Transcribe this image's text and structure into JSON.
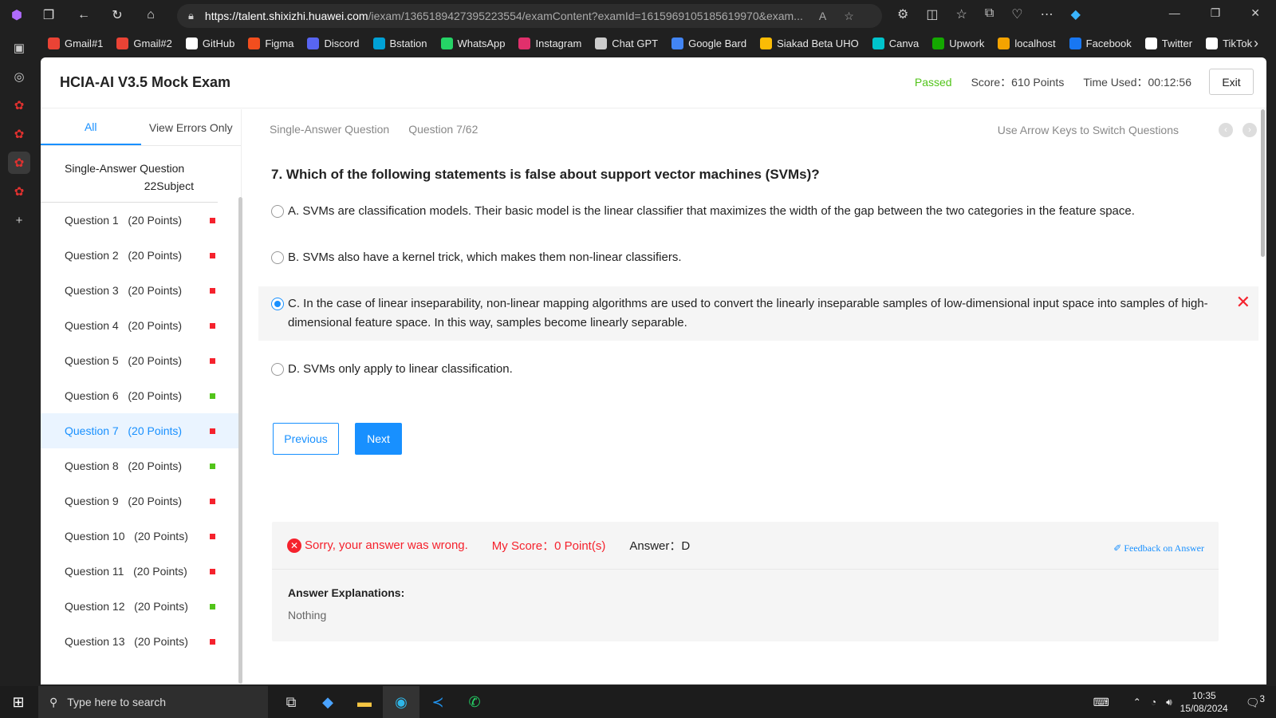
{
  "browser": {
    "url_host": "https://talent.shixizhi.huawei.com",
    "url_path": "/iexam/1365189427395223554/examContent?examId=1615969105185619970&exam...",
    "bookmarks": [
      {
        "label": "Gmail#1",
        "color": "#ea4335"
      },
      {
        "label": "Gmail#2",
        "color": "#ea4335"
      },
      {
        "label": "GitHub",
        "color": "#ffffff"
      },
      {
        "label": "Figma",
        "color": "#f24e1e"
      },
      {
        "label": "Discord",
        "color": "#5865f2"
      },
      {
        "label": "Bstation",
        "color": "#00a1d6"
      },
      {
        "label": "WhatsApp",
        "color": "#25d366"
      },
      {
        "label": "Instagram",
        "color": "#e1306c"
      },
      {
        "label": "Chat GPT",
        "color": "#cccccc"
      },
      {
        "label": "Google Bard",
        "color": "#4285f4"
      },
      {
        "label": "Siakad Beta UHO",
        "color": "#fbbc05"
      },
      {
        "label": "Canva",
        "color": "#00c4cc"
      },
      {
        "label": "Upwork",
        "color": "#14a800"
      },
      {
        "label": "localhost",
        "color": "#f4a300"
      },
      {
        "label": "Facebook",
        "color": "#1877f2"
      },
      {
        "label": "Twitter",
        "color": "#ffffff"
      },
      {
        "label": "TikTok",
        "color": "#ffffff"
      }
    ]
  },
  "header": {
    "title": "HCIA-AI V3.5 Mock Exam",
    "status": "Passed",
    "score": "Score：610 Points",
    "time_used": "Time Used：00:12:56",
    "exit_label": "Exit"
  },
  "sidebar": {
    "tab_all": "All",
    "tab_errors": "View Errors Only",
    "section_title": "Single-Answer Question",
    "section_count": "22Subject",
    "questions": [
      {
        "label": "Question 1   (20 Points)",
        "status": "wrong"
      },
      {
        "label": "Question 2   (20 Points)",
        "status": "wrong"
      },
      {
        "label": "Question 3   (20 Points)",
        "status": "wrong"
      },
      {
        "label": "Question 4   (20 Points)",
        "status": "wrong"
      },
      {
        "label": "Question 5   (20 Points)",
        "status": "wrong"
      },
      {
        "label": "Question 6   (20 Points)",
        "status": "correct"
      },
      {
        "label": "Question 7   (20 Points)",
        "status": "wrong",
        "active": true
      },
      {
        "label": "Question 8   (20 Points)",
        "status": "correct"
      },
      {
        "label": "Question 9   (20 Points)",
        "status": "wrong"
      },
      {
        "label": "Question 10   (20 Points)",
        "status": "wrong"
      },
      {
        "label": "Question 11   (20 Points)",
        "status": "wrong"
      },
      {
        "label": "Question 12   (20 Points)",
        "status": "correct"
      },
      {
        "label": "Question 13   (20 Points)",
        "status": "wrong"
      }
    ],
    "colors": {
      "wrong": "#f5222d",
      "correct": "#52c41a"
    }
  },
  "main": {
    "qtype": "Single-Answer Question",
    "progress": "Question 7/62",
    "hint": "Use Arrow Keys to Switch Questions",
    "question": "7. Which of the following statements is false about support vector machines (SVMs)?",
    "options": [
      {
        "text": "A. SVMs are classification models. Their basic model is the linear classifier that maximizes the width of the gap between the two categories in the feature space.",
        "selected": false
      },
      {
        "text": "B. SVMs also have a kernel trick, which makes them non-linear classifiers.",
        "selected": false
      },
      {
        "text": "C. In the case of linear inseparability, non-linear mapping algorithms are used to convert the linearly inseparable samples of low-dimensional input space into samples of high-dimensional feature space. In this way, samples become linearly separable.",
        "selected": true
      },
      {
        "text": "D. SVMs only apply to linear classification.",
        "selected": false
      }
    ],
    "prev_label": "Previous",
    "next_label": "Next",
    "result_msg": "Sorry, your answer was wrong.",
    "my_score": "My Score：0 Point(s)",
    "answer": "Answer：D",
    "feedback": "Feedback on Answer",
    "explanation_label": "Answer Explanations:",
    "explanation": "Nothing"
  },
  "taskbar": {
    "search_placeholder": "Type here to search",
    "time": "10:35",
    "date": "15/08/2024",
    "notifications": "3"
  }
}
